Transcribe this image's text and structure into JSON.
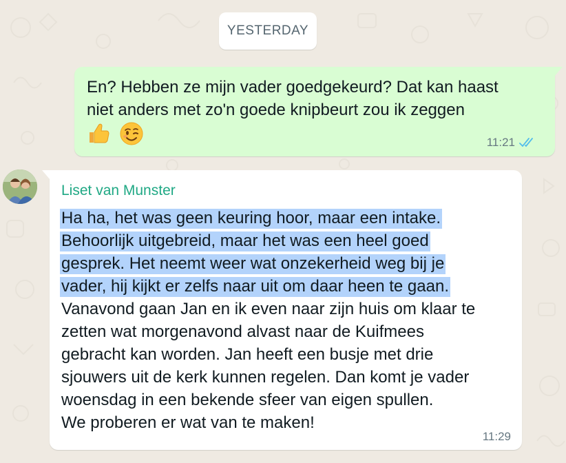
{
  "date_separator": "YESTERDAY",
  "outgoing_message": {
    "lines": [
      "En? Hebben ze mijn vader goedgekeurd? Dat kan haast",
      "niet anders met zo'n goede knipbeurt zou ik zeggen"
    ],
    "emojis": [
      "thumbs-up-icon",
      "winking-face-icon"
    ],
    "time": "11:21",
    "status_icon": "double-check-read-icon",
    "status_color": "#53bdeb",
    "bubble_color": "#d9fdd3"
  },
  "incoming_message": {
    "sender": "Liset van Munster",
    "sender_color": "#1fa884",
    "avatar_icon": "contact-avatar",
    "highlight_color": "#b3d3fb",
    "lines": [
      {
        "text": "Ha ha, het was geen keuring hoor, maar een intake.",
        "highlighted": true
      },
      {
        "text": "Behoorlijk uitgebreid, maar het was een heel goed",
        "highlighted": true
      },
      {
        "text": "gesprek. Het neemt weer wat onzekerheid weg bij je",
        "highlighted": true
      },
      {
        "text": "vader, hij kijkt er zelfs naar uit om daar heen te gaan.",
        "highlighted": true
      },
      {
        "text": "Vanavond gaan Jan en ik even naar zijn huis om klaar te",
        "highlighted": false
      },
      {
        "text": "zetten wat morgenavond alvast naar de Kuifmees",
        "highlighted": false
      },
      {
        "text": "gebracht kan worden. Jan heeft een busje met drie",
        "highlighted": false
      },
      {
        "text": "sjouwers uit de kerk kunnen regelen. Dan komt je vader",
        "highlighted": false
      },
      {
        "text": "woensdag in een bekende sfeer van eigen spullen.",
        "highlighted": false
      },
      {
        "text": "We proberen er wat van te maken!",
        "highlighted": false
      }
    ],
    "time": "11:29",
    "bubble_color": "#ffffff"
  },
  "background_color": "#efeae2"
}
